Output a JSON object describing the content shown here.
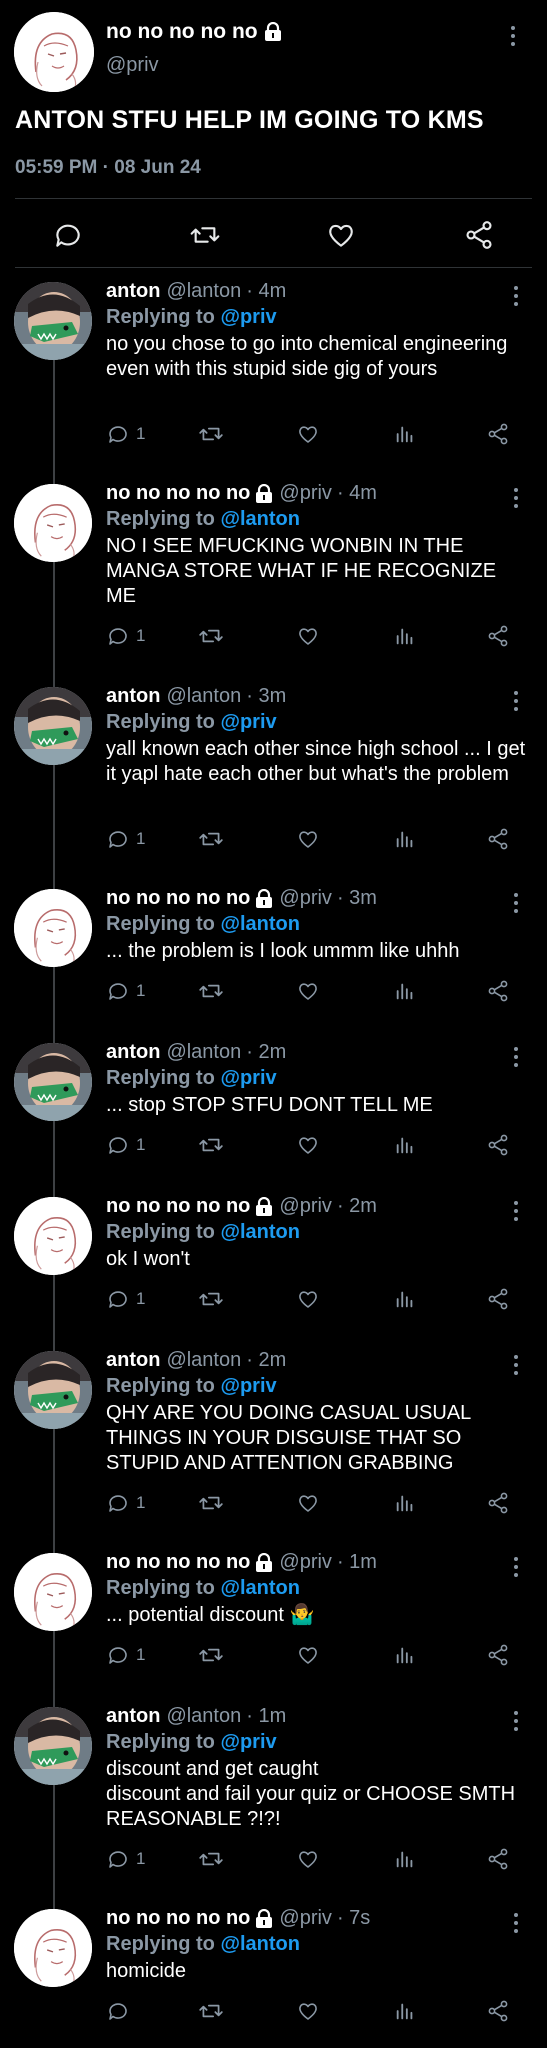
{
  "main_tweet": {
    "author_name": "no no no no no",
    "author_handle": "@priv",
    "text": "ANTON STFU HELP IM GOING TO KMS",
    "timestamp": "05:59 PM · 08 Jun 24"
  },
  "replies": [
    {
      "name": "anton",
      "handle": "@lanton",
      "time": "· 4m",
      "locked": false,
      "avatar": "anton",
      "replying_label": "Replying to",
      "replying_to": "@priv",
      "text": "no you chose to go into chemical engineering even with this stupid side gig of yours",
      "reply_count": "1"
    },
    {
      "name": "no no no no no",
      "handle": "@priv",
      "time": "· 4m",
      "locked": true,
      "avatar": "priv",
      "replying_label": "Replying to",
      "replying_to": "@lanton",
      "text": "NO I SEE MFUCKING WONBIN IN THE MANGA STORE WHAT IF HE RECOGNIZE ME",
      "reply_count": "1"
    },
    {
      "name": "anton",
      "handle": "@lanton",
      "time": "· 3m",
      "locked": false,
      "avatar": "anton",
      "replying_label": "Replying to",
      "replying_to": "@priv",
      "text": "yall known each other since high school ... I get it yapl hate each other but what's the problem",
      "reply_count": "1"
    },
    {
      "name": "no no no no no",
      "handle": "@priv",
      "time": "· 3m",
      "locked": true,
      "avatar": "priv",
      "replying_label": "Replying to",
      "replying_to": "@lanton",
      "text": "... the problem is I look ummm like uhhh",
      "reply_count": "1"
    },
    {
      "name": "anton",
      "handle": "@lanton",
      "time": "· 2m",
      "locked": false,
      "avatar": "anton",
      "replying_label": "Replying to",
      "replying_to": "@priv",
      "text": "... stop STOP STFU DONT TELL ME",
      "reply_count": "1"
    },
    {
      "name": "no no no no no",
      "handle": "@priv",
      "time": "· 2m",
      "locked": true,
      "avatar": "priv",
      "replying_label": "Replying to",
      "replying_to": "@lanton",
      "text": "ok I won't",
      "reply_count": "1"
    },
    {
      "name": "anton",
      "handle": "@lanton",
      "time": "· 2m",
      "locked": false,
      "avatar": "anton",
      "replying_label": "Replying to",
      "replying_to": "@priv",
      "text": "QHY ARE YOU DOING CASUAL USUAL THINGS IN YOUR DISGUISE THAT SO STUPID AND ATTENTION GRABBING",
      "reply_count": "1"
    },
    {
      "name": "no no no no no",
      "handle": "@priv",
      "time": "· 1m",
      "locked": true,
      "avatar": "priv",
      "replying_label": "Replying to",
      "replying_to": "@lanton",
      "text": "... potential discount 🤷‍♂️",
      "reply_count": "1"
    },
    {
      "name": "anton",
      "handle": "@lanton",
      "time": "· 1m",
      "locked": false,
      "avatar": "anton",
      "replying_label": "Replying to",
      "replying_to": "@priv",
      "text": "discount and get caught\ndiscount and fail your quiz or CHOOSE SMTH REASONABLE ?!?!",
      "reply_count": "1"
    },
    {
      "name": "no no no no no",
      "handle": "@priv",
      "time": "· 7s",
      "locked": true,
      "avatar": "priv",
      "replying_label": "Replying to",
      "replying_to": "@lanton",
      "text": "homicide",
      "reply_count": ""
    }
  ],
  "icons": {
    "reply": "comment-icon",
    "retweet": "retweet-icon",
    "like": "heart-icon",
    "views": "bar-chart-icon",
    "share": "share-icon",
    "more": "more-vertical-icon",
    "lock": "lock-icon"
  },
  "colors": {
    "background": "#000000",
    "text": "#e7e9ea",
    "muted": "#8b98a5",
    "link": "#1d9bf0",
    "divider": "#2f3336"
  }
}
